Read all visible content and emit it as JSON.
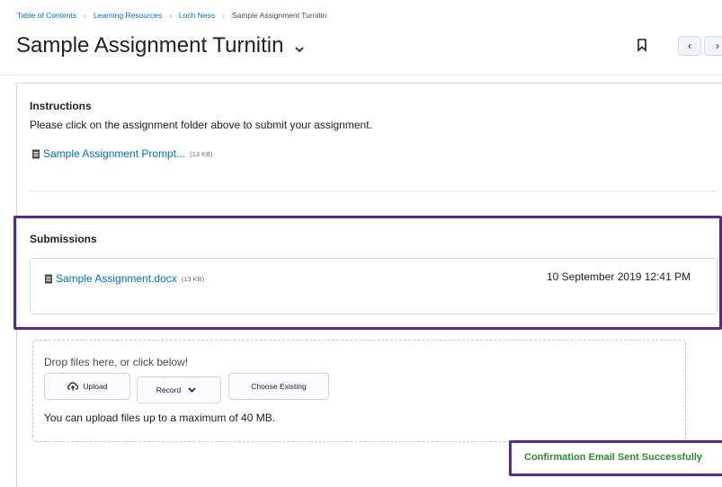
{
  "breadcrumb": {
    "items": [
      "Table of Contents",
      "Learning Resources",
      "Loch Ness"
    ],
    "current": "Sample Assignment Turnitin"
  },
  "page": {
    "title": "Sample Assignment Turnitin"
  },
  "nav": {
    "prev_symbol": "‹",
    "next_symbol": "›"
  },
  "instructions": {
    "heading": "Instructions",
    "text": "Please click on the assignment folder above to submit your assignment.",
    "attachment": {
      "name": "Sample Assignment Prompt...",
      "size": "(13 KB)"
    }
  },
  "submissions": {
    "heading": "Submissions",
    "file": {
      "name": "Sample Assignment.docx",
      "size": "(13 KB)"
    },
    "date": "10 September 2019 12:41 PM"
  },
  "upload": {
    "drop_text": "Drop files here, or click below!",
    "upload_label": "Upload",
    "record_label": "Record",
    "choose_label": "Choose Existing",
    "limit_text": "You can upload files up to a maximum of 40 MB."
  },
  "toast": {
    "message": "Confirmation Email Sent Successfully"
  },
  "colors": {
    "link": "#006fbf",
    "highlight": "#5b2a86",
    "success": "#2e8a2c"
  }
}
